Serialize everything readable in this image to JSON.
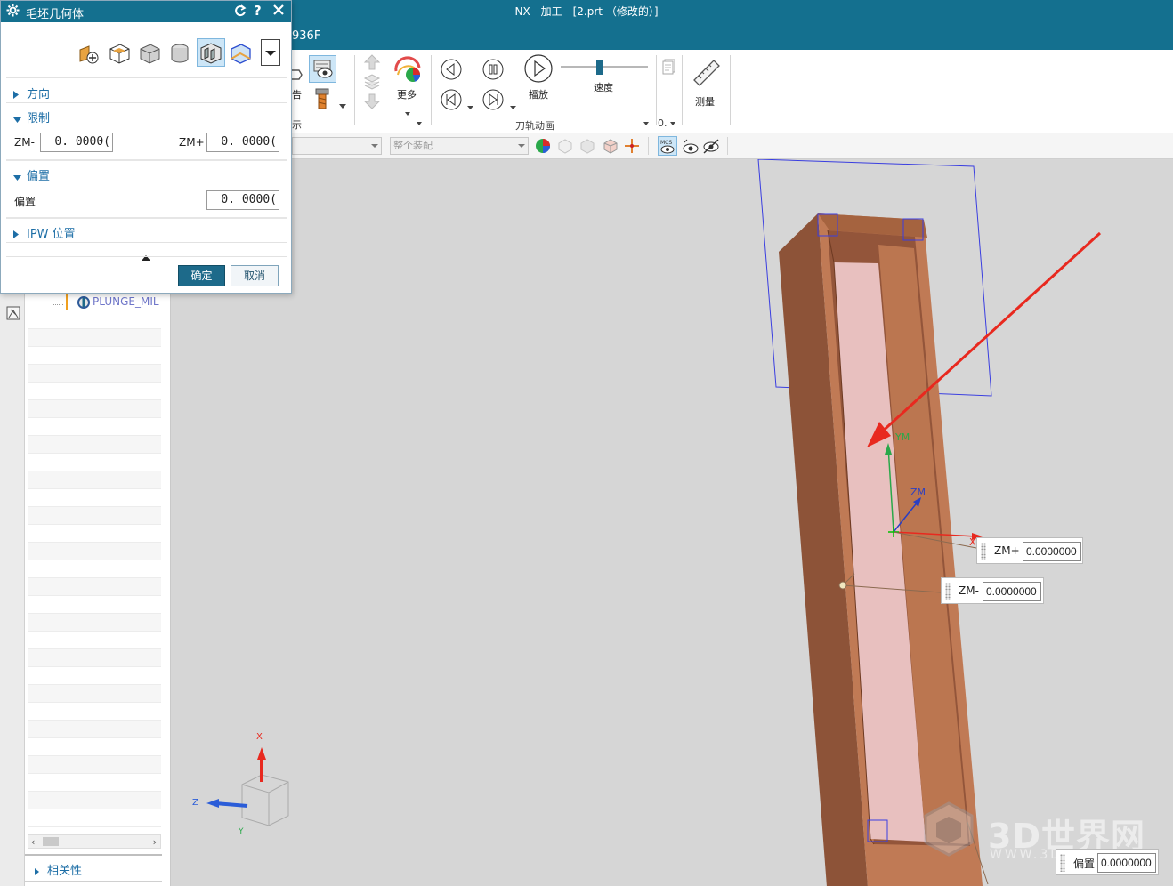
{
  "window": {
    "title": "NX - 加工 - [2.prt （修改的）]",
    "title_fragment": "936F",
    "accent": "#14708f"
  },
  "ribbon": {
    "report_fragment": "告",
    "more_label": "更多",
    "group_fragment": "示",
    "play_label": "播放",
    "speed_label": "速度",
    "group_animation": "刀轨动画",
    "measure_label": "测量",
    "overflow_label": "0."
  },
  "toolbar": {
    "assembly_combo": "整个装配"
  },
  "dialog": {
    "title": "毛坯几何体",
    "sections": {
      "direction": "方向",
      "limits": "限制",
      "offset": "偏置",
      "ipw_position": "IPW 位置"
    },
    "zm_minus_label": "ZM-",
    "zm_minus_value": "0. 0000(",
    "zm_plus_label": "ZM+",
    "zm_plus_value": "0. 0000(",
    "offset_label": "偏置",
    "offset_value": "0. 0000(",
    "ok_label": "确定",
    "cancel_label": "取消"
  },
  "navigator": {
    "operation_label": "PLUNGE_MIL",
    "relevance_label": "相关性"
  },
  "viewport": {
    "zm_label": "ZM",
    "xm_label": "X",
    "ym_label": "YM",
    "zm_plus_handle_label": "ZM+",
    "zm_plus_handle_value": "0.0000000",
    "zm_minus_handle_label": "ZM-",
    "zm_minus_handle_value": "0.0000000",
    "offset_handle_label": "偏置",
    "offset_handle_value": "0.0000000",
    "triad_x": "X",
    "triad_y": "Y",
    "triad_z": "Z",
    "watermark_text": "3D世界网",
    "watermark_sub": "WWW.3D"
  }
}
